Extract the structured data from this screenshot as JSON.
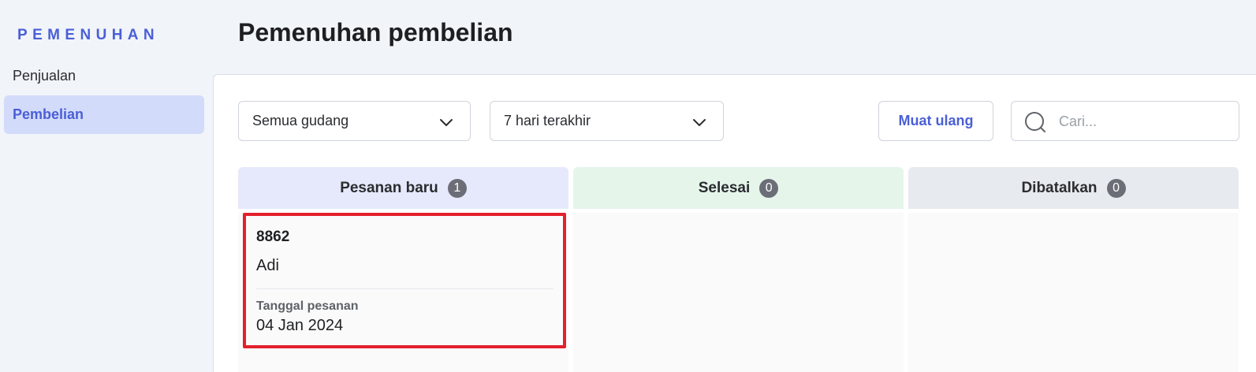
{
  "sidebar": {
    "heading": "PEMENUHAN",
    "items": [
      {
        "label": "Penjualan",
        "active": false
      },
      {
        "label": "Pembelian",
        "active": true
      }
    ]
  },
  "page": {
    "title": "Pemenuhan pembelian"
  },
  "filters": {
    "warehouse": {
      "value": "Semua gudang",
      "icon": "chevron-down-icon"
    },
    "period": {
      "value": "7 hari terakhir",
      "icon": "chevron-down-icon"
    }
  },
  "actions": {
    "reload_label": "Muat ulang"
  },
  "search": {
    "placeholder": "Cari...",
    "value": "",
    "icon": "search-icon"
  },
  "columns": [
    {
      "title": "Pesanan baru",
      "count": "1",
      "color": "#e6e9fb"
    },
    {
      "title": "Selesai",
      "count": "0",
      "color": "#e5f5ea"
    },
    {
      "title": "Dibatalkan",
      "count": "0",
      "color": "#e7eaee"
    }
  ],
  "orders": [
    {
      "id": "8862",
      "customer": "Adi",
      "date_label": "Tanggal pesanan",
      "date": "04 Jan 2024"
    }
  ],
  "colors": {
    "accent": "#4a5fd6",
    "highlight_border": "#e3202c",
    "badge": "#6b6e76"
  }
}
